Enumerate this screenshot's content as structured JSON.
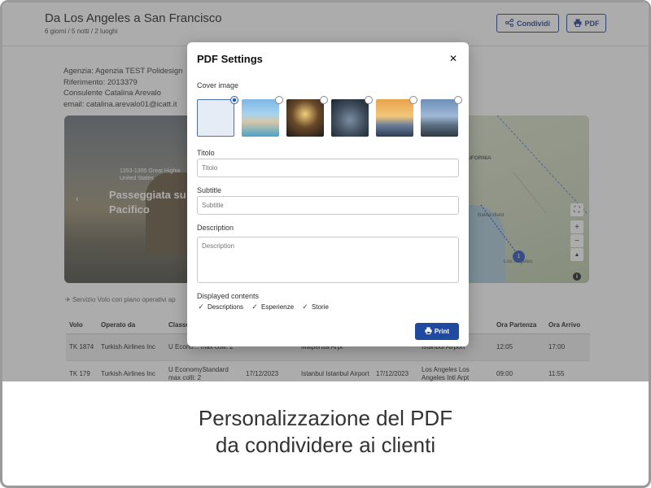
{
  "header": {
    "title": "Da Los Angeles a San Francisco",
    "subtitle": "6 giorni / 5 notti / 2 luoghi",
    "share_label": "Condividi",
    "pdf_label": "PDF"
  },
  "agency": {
    "agency_line": "Agenzia: Agenzia TEST Polidesign",
    "reference_line": "Riferimento: 2013379",
    "consultant_line": "Consulente Catalina Arevalo",
    "email_line": "email: catalina.arevalo01@icatt.it"
  },
  "hero": {
    "address_line1": "1353-1395 Great Highw",
    "address_line2": "United States",
    "title_line1": "Passeggiata su",
    "title_line2": "Pacifico"
  },
  "map": {
    "label_state": "LIFORNIA",
    "label_place": "Bakersfield",
    "label_city": "Los Angeles",
    "pin_count": "1"
  },
  "notice": "Servizio Volo con piano operativi ap",
  "flights": {
    "headers": [
      "Volo",
      "Operato da",
      "Classe",
      "",
      "",
      "",
      "",
      "Ora Partenza",
      "Ora Arrivo"
    ],
    "rows": [
      [
        "TK 1874",
        "Turkish Airlines Inc",
        "U Econo... max colli: 2",
        "",
        "Malpensa Arpt",
        "",
        "Istanbul Airport",
        "12:05",
        "17:00"
      ],
      [
        "TK 179",
        "Turkish Airlines Inc",
        "U EconomyStandard max colli: 2",
        "17/12/2023",
        "Istanbul Istanbul Airport",
        "17/12/2023",
        "Los Angeles Los Angeles Intl Arpt",
        "09:00",
        "11:55"
      ]
    ]
  },
  "modal": {
    "title": "PDF Settings",
    "cover_label": "Cover image",
    "titolo_label": "Titolo",
    "titolo_placeholder": "Titolo",
    "subtitle_label": "Subtitle",
    "subtitle_placeholder": "Subtitle",
    "description_label": "Description",
    "description_placeholder": "Description",
    "displayed_label": "Displayed contents",
    "checks": [
      "Descriptions",
      "Esperienze",
      "Storie"
    ],
    "print_label": "Print"
  },
  "caption": {
    "line1": "Personalizzazione del PDF",
    "line2": "da condividere ai clienti"
  },
  "colors": {
    "accent": "#1f4aa0",
    "header_button": "#1f3f8f"
  }
}
